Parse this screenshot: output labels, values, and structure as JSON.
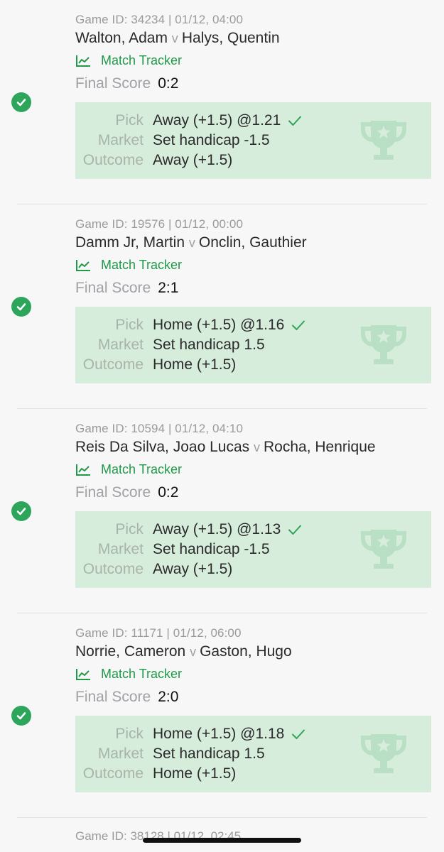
{
  "labels": {
    "match_tracker": "Match Tracker",
    "final_score": "Final Score",
    "pick": "Pick",
    "market": "Market",
    "outcome": "Outcome",
    "versus": "v"
  },
  "colors": {
    "win_green": "#2da55a",
    "tracker_green": "#1f9a48",
    "card_bg": "#d7eddb"
  },
  "bets": [
    {
      "meta": "Game ID: 34234 | 01/12, 04:00",
      "home": "Walton, Adam",
      "away": "Halys, Quentin",
      "score": "0:2",
      "pick": "Away (+1.5) @1.21",
      "market": "Set handicap -1.5",
      "outcome": "Away (+1.5)",
      "status_icon": "check-circle-icon"
    },
    {
      "meta": "Game ID: 19576 | 01/12, 00:00",
      "home": "Damm Jr, Martin",
      "away": "Onclin, Gauthier",
      "score": "2:1",
      "pick": "Home (+1.5) @1.16",
      "market": "Set handicap 1.5",
      "outcome": "Home (+1.5)",
      "status_icon": "check-circle-icon"
    },
    {
      "meta": "Game ID: 10594 | 01/12, 04:10",
      "home": "Reis Da Silva, Joao Lucas",
      "away": "Rocha, Henrique",
      "score": "0:2",
      "pick": "Away (+1.5) @1.13",
      "market": "Set handicap -1.5",
      "outcome": "Away (+1.5)",
      "status_icon": "check-circle-icon"
    },
    {
      "meta": "Game ID: 11171 | 01/12, 06:00",
      "home": "Norrie, Cameron",
      "away": "Gaston, Hugo",
      "score": "2:0",
      "pick": "Home (+1.5) @1.18",
      "market": "Set handicap 1.5",
      "outcome": "Home (+1.5)",
      "status_icon": "check-circle-icon"
    }
  ],
  "partial_bet": {
    "meta": "Game ID: 38128 | 01/12, 02:45"
  }
}
